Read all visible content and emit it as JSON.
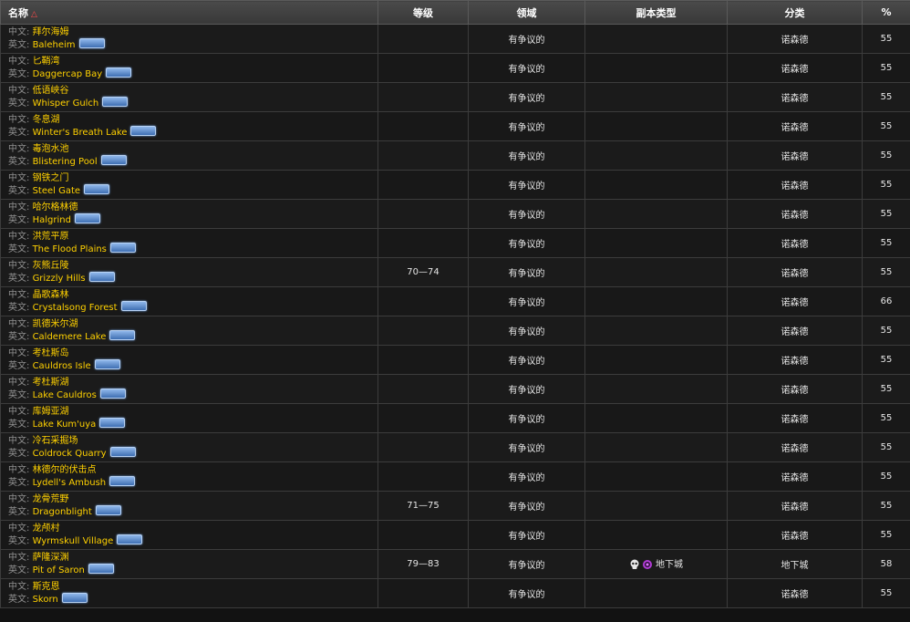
{
  "headers": {
    "name": "名称",
    "level": "等级",
    "territory": "领域",
    "instance_type": "副本类型",
    "category": "分类",
    "percent": "%"
  },
  "labels": {
    "zh": "中文:",
    "en": "英文:"
  },
  "rows": [
    {
      "zh": "拜尔海姆",
      "en": "Baleheim",
      "level": "",
      "territory": "有争议的",
      "instance_type": "",
      "category": "诺森德",
      "percent": "55"
    },
    {
      "zh": "匕鞘湾",
      "en": "Daggercap Bay",
      "level": "",
      "territory": "有争议的",
      "instance_type": "",
      "category": "诺森德",
      "percent": "55"
    },
    {
      "zh": "低语峡谷",
      "en": "Whisper Gulch",
      "level": "",
      "territory": "有争议的",
      "instance_type": "",
      "category": "诺森德",
      "percent": "55"
    },
    {
      "zh": "冬息湖",
      "en": "Winter's Breath Lake",
      "level": "",
      "territory": "有争议的",
      "instance_type": "",
      "category": "诺森德",
      "percent": "55"
    },
    {
      "zh": "毒泡水池",
      "en": "Blistering Pool",
      "level": "",
      "territory": "有争议的",
      "instance_type": "",
      "category": "诺森德",
      "percent": "55"
    },
    {
      "zh": "钢铁之门",
      "en": "Steel Gate",
      "level": "",
      "territory": "有争议的",
      "instance_type": "",
      "category": "诺森德",
      "percent": "55"
    },
    {
      "zh": "哈尔格林德",
      "en": "Halgrind",
      "level": "",
      "territory": "有争议的",
      "instance_type": "",
      "category": "诺森德",
      "percent": "55"
    },
    {
      "zh": "洪荒平原",
      "en": "The Flood Plains",
      "level": "",
      "territory": "有争议的",
      "instance_type": "",
      "category": "诺森德",
      "percent": "55"
    },
    {
      "zh": "灰熊丘陵",
      "en": "Grizzly Hills",
      "level": "70—74",
      "territory": "有争议的",
      "instance_type": "",
      "category": "诺森德",
      "percent": "55"
    },
    {
      "zh": "晶歌森林",
      "en": "Crystalsong Forest",
      "level": "",
      "territory": "有争议的",
      "instance_type": "",
      "category": "诺森德",
      "percent": "66"
    },
    {
      "zh": "凯德米尔湖",
      "en": "Caldemere Lake",
      "level": "",
      "territory": "有争议的",
      "instance_type": "",
      "category": "诺森德",
      "percent": "55"
    },
    {
      "zh": "考杜斯岛",
      "en": "Cauldros Isle",
      "level": "",
      "territory": "有争议的",
      "instance_type": "",
      "category": "诺森德",
      "percent": "55"
    },
    {
      "zh": "考杜斯湖",
      "en": "Lake Cauldros",
      "level": "",
      "territory": "有争议的",
      "instance_type": "",
      "category": "诺森德",
      "percent": "55"
    },
    {
      "zh": "库姆亚湖",
      "en": "Lake Kum'uya",
      "level": "",
      "territory": "有争议的",
      "instance_type": "",
      "category": "诺森德",
      "percent": "55"
    },
    {
      "zh": "冷石采掘场",
      "en": "Coldrock Quarry",
      "level": "",
      "territory": "有争议的",
      "instance_type": "",
      "category": "诺森德",
      "percent": "55"
    },
    {
      "zh": "林德尔的伏击点",
      "en": "Lydell's Ambush",
      "level": "",
      "territory": "有争议的",
      "instance_type": "",
      "category": "诺森德",
      "percent": "55"
    },
    {
      "zh": "龙骨荒野",
      "en": "Dragonblight",
      "level": "71—75",
      "territory": "有争议的",
      "instance_type": "",
      "category": "诺森德",
      "percent": "55"
    },
    {
      "zh": "龙颅村",
      "en": "Wyrmskull Village",
      "level": "",
      "territory": "有争议的",
      "instance_type": "",
      "category": "诺森德",
      "percent": "55"
    },
    {
      "zh": "萨隆深渊",
      "en": "Pit of Saron",
      "level": "79—83",
      "territory": "有争议的",
      "instance_type": "地下城",
      "category": "地下城",
      "percent": "58"
    },
    {
      "zh": "斯克恩",
      "en": "Skorn",
      "level": "",
      "territory": "有争议的",
      "instance_type": "",
      "category": "诺森德",
      "percent": "55"
    }
  ],
  "icons": {
    "sort": "sort-asc-icon",
    "expansion": "wotlk-expansion-icon",
    "heroic": "skull-icon",
    "dungeon": "dungeon-portal-icon"
  },
  "colors": {
    "name_text": "#ffd100",
    "label_text": "#8f8f8f",
    "header_bg": "#404040",
    "row_bg": "#1b1b1b"
  }
}
